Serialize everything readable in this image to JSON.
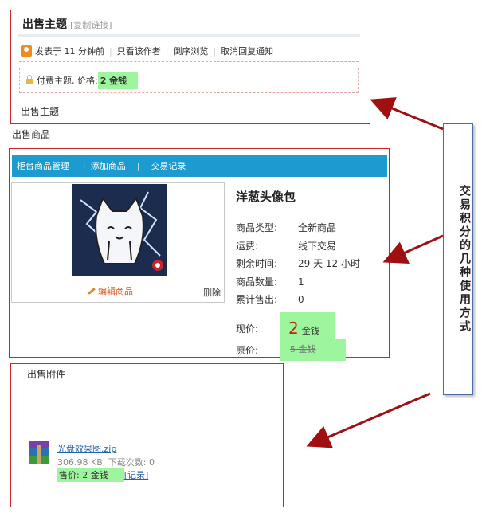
{
  "thread": {
    "title": "出售主题",
    "copy_link": "[复制链接]",
    "meta": [
      "发表于 11 分钟前",
      "只看该作者",
      "倒序浏览",
      "取消回复通知"
    ],
    "paid_label": "付费主题, 价格:",
    "paid_price": " 2 金钱",
    "body": "出售主题"
  },
  "goods_section_title": "出售商品",
  "goods": {
    "toolbar": [
      "柜台商品管理",
      "+ 添加商品",
      "|",
      "交易记录"
    ],
    "name": "洋葱头像包",
    "edit_label": "编辑商品",
    "delete_label": "删除",
    "attrs": [
      {
        "k": "商品类型:",
        "v": "全新商品"
      },
      {
        "k": "运费:",
        "v": "线下交易"
      },
      {
        "k": "剩余时间:",
        "v": "29 天 12 小时"
      },
      {
        "k": "商品数量:",
        "v": "1"
      },
      {
        "k": "累计售出:",
        "v": "0"
      }
    ],
    "price_now_label": "现价:",
    "price_now_value": "2",
    "price_now_unit": "金钱",
    "price_old_label": "原价:",
    "price_old_value": "5 金钱"
  },
  "attach": {
    "title": "出售附件",
    "file_name": "光盘效果图.zip",
    "file_meta": "306.98 KB, 下载次数: 0",
    "price_label": "售价: 2 金钱",
    "record_label": "[记录]"
  },
  "callout": {
    "text": "交易积分的几种使用方式"
  },
  "colors": {
    "frame_red": "#c9252b",
    "toolbar_blue": "#1c9bd0",
    "highlight_green": "#9df59d",
    "arrow_red": "#a01010"
  }
}
